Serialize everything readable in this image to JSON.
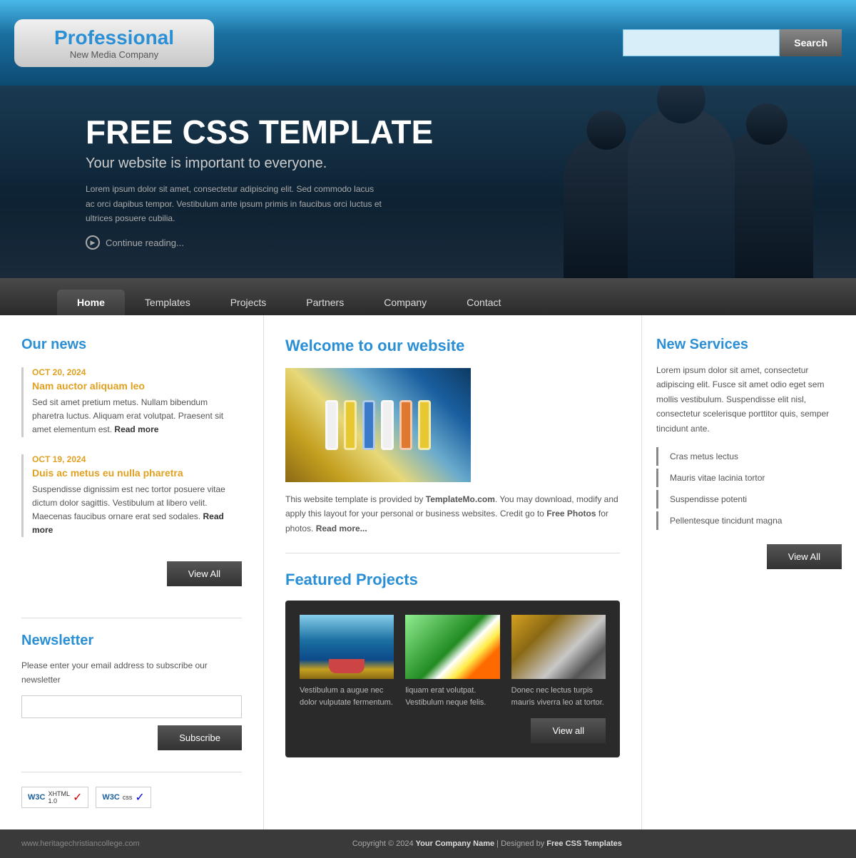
{
  "header": {
    "logo": {
      "company_name": "Professional",
      "company_sub": "New Media Company"
    },
    "search": {
      "placeholder": "",
      "button_label": "Search"
    }
  },
  "hero": {
    "headline": "FREE CSS TEMPLATE",
    "subheadline": "Your website is important to everyone.",
    "body": "Lorem ipsum dolor sit amet, consectetur adipiscing elit. Sed commodo lacus ac orci dapibus tempor. Vestibulum ante ipsum primis in faucibus orci luctus et ultrices posuere cubilia.",
    "continue_label": "Continue reading..."
  },
  "nav": {
    "items": [
      {
        "label": "Home",
        "active": true
      },
      {
        "label": "Templates",
        "active": false
      },
      {
        "label": "Projects",
        "active": false
      },
      {
        "label": "Partners",
        "active": false
      },
      {
        "label": "Company",
        "active": false
      },
      {
        "label": "Contact",
        "active": false
      }
    ]
  },
  "sidebar_left": {
    "our_news_heading": "Our news",
    "news_items": [
      {
        "date": "OCT 20, 2024",
        "title": "Nam auctor aliquam leo",
        "text": "Sed sit amet pretium metus. Nullam bibendum pharetra luctus. Aliquam erat volutpat. Praesent sit amet elementum est.",
        "read_more": "Read more"
      },
      {
        "date": "OCT 19, 2024",
        "title": "Duis ac metus eu nulla pharetra",
        "text": "Suspendisse dignissim est nec tortor posuere vitae dictum dolor sagittis. Vestibulum at libero velit. Maecenas faucibus ornare erat sed sodales.",
        "read_more": "Read more"
      }
    ],
    "view_all_label": "View All",
    "newsletter": {
      "heading": "Newsletter",
      "description": "Please enter your email address to subscribe our newsletter",
      "email_placeholder": "",
      "subscribe_label": "Subscribe"
    },
    "w3c": {
      "xhtml_label": "W3C XHTML 1.0",
      "css_label": "W3C css"
    }
  },
  "content_center": {
    "welcome_heading": "Welcome to our website",
    "intro_text": "This website template is provided by ",
    "template_mo": "TemplateMo.com",
    "intro_text2": ". You may download, modify and apply this layout for your personal or business websites. Credit go to ",
    "free_photos": "Free Photos",
    "intro_text3": " for photos. ",
    "read_more": "Read more...",
    "featured_projects_heading": "Featured Projects",
    "projects": [
      {
        "caption": "Vestibulum a augue nec dolor vulputate fermentum."
      },
      {
        "caption": "liquam erat volutpat. Vestibulum neque felis."
      },
      {
        "caption": "Donec nec lectus turpis mauris viverra leo at tortor."
      }
    ],
    "view_all_projects_label": "View all"
  },
  "sidebar_right": {
    "heading": "New Services",
    "intro": "Lorem ipsum dolor sit amet, consectetur adipiscing elit. Fusce sit amet odio eget sem mollis vestibulum. Suspendisse elit nisl, consectetur scelerisque porttitor quis, semper tincidunt ante.",
    "services": [
      "Cras metus lectus",
      "Mauris vitae lacinia tortor",
      "Suspendisse potenti",
      "Pellentesque tincidunt magna"
    ],
    "view_all_label": "View All"
  },
  "footer": {
    "left_text": "www.heritagechristiancollege.com",
    "copyright": "Copyright © 2024 ",
    "company_name": "Your Company Name",
    "designed_by": " | Designed by ",
    "designer": "Free CSS Templates"
  }
}
